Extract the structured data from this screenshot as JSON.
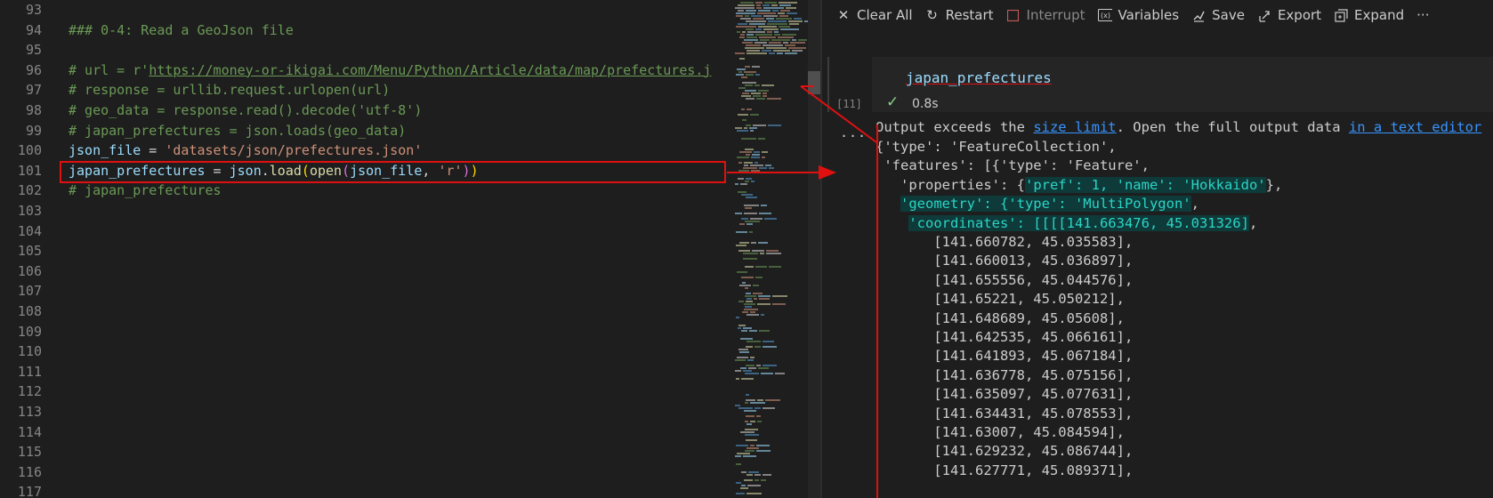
{
  "editor": {
    "lines": [
      {
        "num": "93",
        "segments": []
      },
      {
        "num": "94",
        "segments": [
          {
            "t": "### 0-4: Read a GeoJson file",
            "c": "c-h"
          }
        ]
      },
      {
        "num": "95",
        "segments": []
      },
      {
        "num": "96",
        "segments": [
          {
            "t": "# url = r'",
            "c": "c-comment"
          },
          {
            "t": "https://money-or-ikigai.com/Menu/Python/Article/data/map/prefectures.j",
            "c": "c-link"
          }
        ]
      },
      {
        "num": "97",
        "segments": [
          {
            "t": "# response = urllib.request.urlopen(url)",
            "c": "c-comment"
          }
        ]
      },
      {
        "num": "98",
        "segments": [
          {
            "t": "# geo_data = response.read().decode('utf-8')",
            "c": "c-comment"
          }
        ]
      },
      {
        "num": "99",
        "segments": [
          {
            "t": "# japan_prefectures = json.loads(geo_data)",
            "c": "c-comment"
          }
        ]
      },
      {
        "num": "100",
        "segments": [
          {
            "t": "json_file",
            "c": "c-var"
          },
          {
            "t": " = ",
            "c": "c-op"
          },
          {
            "t": "'datasets/json/prefectures.json'",
            "c": "c-str"
          }
        ]
      },
      {
        "num": "101",
        "segments": [
          {
            "t": "japan_prefectures",
            "c": "c-var"
          },
          {
            "t": " = ",
            "c": "c-op"
          },
          {
            "t": "json",
            "c": "c-var"
          },
          {
            "t": ".",
            "c": "c-op"
          },
          {
            "t": "load",
            "c": "c-fn"
          },
          {
            "t": "(",
            "c": "c-p1"
          },
          {
            "t": "open",
            "c": "c-fn"
          },
          {
            "t": "(",
            "c": "c-p2"
          },
          {
            "t": "json_file",
            "c": "c-var"
          },
          {
            "t": ", ",
            "c": "c-op"
          },
          {
            "t": "'r'",
            "c": "c-str"
          },
          {
            "t": ")",
            "c": "c-p2"
          },
          {
            "t": ")",
            "c": "c-p1"
          }
        ]
      },
      {
        "num": "102",
        "segments": [
          {
            "t": "# japan_prefectures",
            "c": "c-comment"
          }
        ]
      },
      {
        "num": "103",
        "segments": []
      },
      {
        "num": "104",
        "segments": []
      },
      {
        "num": "105",
        "segments": []
      },
      {
        "num": "106",
        "segments": []
      },
      {
        "num": "107",
        "segments": []
      },
      {
        "num": "108",
        "segments": []
      },
      {
        "num": "109",
        "segments": []
      },
      {
        "num": "110",
        "segments": []
      },
      {
        "num": "111",
        "segments": []
      },
      {
        "num": "112",
        "segments": []
      },
      {
        "num": "113",
        "segments": []
      },
      {
        "num": "114",
        "segments": []
      },
      {
        "num": "115",
        "segments": []
      },
      {
        "num": "116",
        "segments": []
      },
      {
        "num": "117",
        "segments": []
      }
    ]
  },
  "toolbar": {
    "clear_all": "Clear All",
    "restart": "Restart",
    "interrupt": "Interrupt",
    "variables": "Variables",
    "save": "Save",
    "export": "Export",
    "expand": "Expand",
    "more": "···"
  },
  "cell": {
    "input": "japan_prefectures",
    "exec_count": "[11]",
    "duration": "0.8s",
    "more": "..."
  },
  "output": {
    "notice_prefix": "Output exceeds the ",
    "size_limit_link": "size limit",
    "notice_middle": ". Open the full output data ",
    "text_editor_link": "in a text editor",
    "lines": [
      [
        {
          "t": "{'type': 'FeatureCollection',"
        }
      ],
      [
        {
          "t": " 'features': [{'type': 'Feature',"
        }
      ],
      [
        {
          "t": "   'properties': {"
        },
        {
          "t": "'pref': 1, 'name': 'Hokkaido'",
          "h": true
        },
        {
          "t": "},"
        }
      ],
      [
        {
          "t": "   "
        },
        {
          "t": "'geometry': {'type': 'MultiPolygon'",
          "h": true
        },
        {
          "t": ","
        }
      ],
      [
        {
          "t": "    "
        },
        {
          "t": "'coordinates': [[[[141.663476, 45.031326]",
          "h": true
        },
        {
          "t": ","
        }
      ],
      [
        {
          "t": "       [141.660782, 45.035583],"
        }
      ],
      [
        {
          "t": "       [141.660013, 45.036897],"
        }
      ],
      [
        {
          "t": "       [141.655556, 45.044576],"
        }
      ],
      [
        {
          "t": "       [141.65221, 45.050212],"
        }
      ],
      [
        {
          "t": "       [141.648689, 45.05608],"
        }
      ],
      [
        {
          "t": "       [141.642535, 45.066161],"
        }
      ],
      [
        {
          "t": "       [141.641893, 45.067184],"
        }
      ],
      [
        {
          "t": "       [141.636778, 45.075156],"
        }
      ],
      [
        {
          "t": "       [141.635097, 45.077631],"
        }
      ],
      [
        {
          "t": "       [141.634431, 45.078553],"
        }
      ],
      [
        {
          "t": "       [141.63007, 45.084594],"
        }
      ],
      [
        {
          "t": "       [141.629232, 45.086744],"
        }
      ],
      [
        {
          "t": "       [141.627771, 45.089371],"
        }
      ]
    ]
  },
  "colors": {
    "annotation_red": "#e01010",
    "background": "#1e1e1e"
  }
}
